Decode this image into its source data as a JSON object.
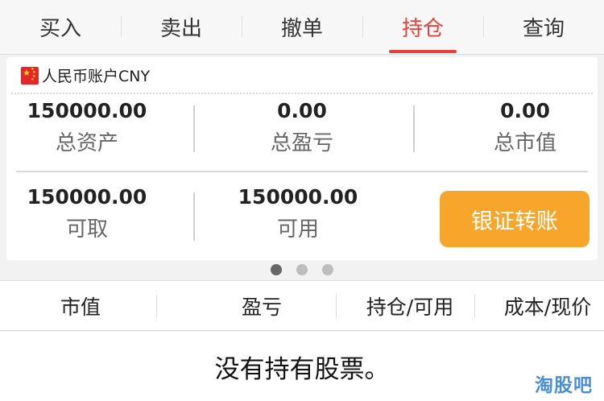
{
  "tabs": [
    {
      "label": "买入"
    },
    {
      "label": "卖出"
    },
    {
      "label": "撤单"
    },
    {
      "label": "持仓",
      "active": true
    },
    {
      "label": "查询"
    }
  ],
  "account": {
    "name": "人民币账户CNY",
    "stats": {
      "total_assets": {
        "value": "150000.00",
        "label": "总资产"
      },
      "total_pnl": {
        "value": "0.00",
        "label": "总盈亏"
      },
      "market_value": {
        "value": "0.00",
        "label": "总市值"
      },
      "withdrawable": {
        "value": "150000.00",
        "label": "可取"
      },
      "available": {
        "value": "150000.00",
        "label": "可用"
      }
    },
    "transfer_button": "银证转账"
  },
  "pagination": {
    "count": 3,
    "active_index": 1
  },
  "holdings": {
    "columns": [
      "市值",
      "盈亏",
      "持仓/可用",
      "成本/现价"
    ],
    "empty_message": "没有持有股票。"
  },
  "watermark": "淘股吧",
  "colors": {
    "accent": "#e8413a",
    "button": "#f8a62b",
    "watermark": "#4a8fd6"
  }
}
